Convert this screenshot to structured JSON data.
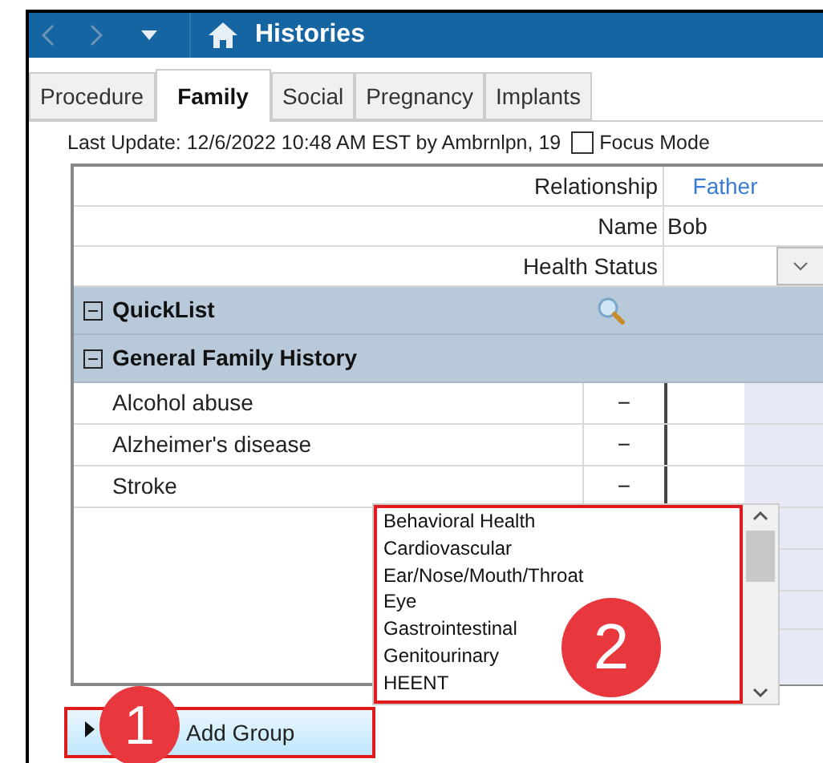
{
  "window": {
    "title": "Histories"
  },
  "tabs": [
    {
      "label": "Procedure",
      "selected": false
    },
    {
      "label": "Family",
      "selected": true
    },
    {
      "label": "Social",
      "selected": false
    },
    {
      "label": "Pregnancy",
      "selected": false
    },
    {
      "label": "Implants",
      "selected": false
    }
  ],
  "last_update": "Last Update: 12/6/2022 10:48 AM EST by Ambrnlpn, 19",
  "focus_mode": {
    "label": "Focus Mode",
    "checked": false
  },
  "header_fields": [
    {
      "label": "Relationship",
      "value": "Father",
      "kind": "link"
    },
    {
      "label": "Name",
      "value": "Bob",
      "kind": "text"
    },
    {
      "label": "Health Status",
      "kind": "select"
    }
  ],
  "groups": [
    {
      "title": "QuickList",
      "expanded": true,
      "kind": "search"
    },
    {
      "title": "General Family History",
      "expanded": true,
      "kind": "list",
      "items": [
        {
          "name": "Alcohol abuse",
          "status": "−"
        },
        {
          "name": "Alzheimer's disease",
          "status": "−"
        },
        {
          "name": "Stroke",
          "status": "−"
        }
      ]
    }
  ],
  "group_list": {
    "items": [
      "Behavioral Health",
      "Cardiovascular",
      "Ear/Nose/Mouth/Throat",
      "Eye",
      "Gastrointestinal",
      "Genitourinary",
      "HEENT"
    ]
  },
  "add_group_button": "Add Group",
  "annotations": [
    "1",
    "2"
  ]
}
